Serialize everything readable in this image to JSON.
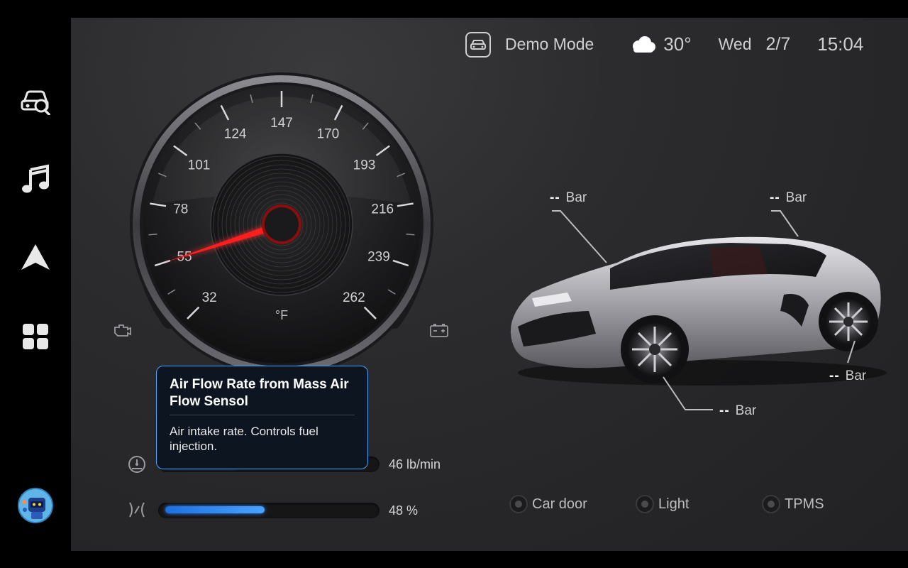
{
  "header": {
    "mode_label": "Demo Mode",
    "temperature": "30°",
    "day": "Wed",
    "date": "2/7",
    "time": "15:04"
  },
  "sidebar": {
    "items": [
      {
        "name": "car-diagnostics",
        "icon": "car-search-icon"
      },
      {
        "name": "music",
        "icon": "music-note-icon"
      },
      {
        "name": "navigation",
        "icon": "navigation-arrow-icon"
      },
      {
        "name": "apps",
        "icon": "apps-grid-icon"
      },
      {
        "name": "assistant",
        "icon": "robot-avatar-icon"
      }
    ]
  },
  "gauge": {
    "ticks": [
      "32",
      "55",
      "78",
      "101",
      "124",
      "147",
      "170",
      "193",
      "216",
      "239",
      "262"
    ],
    "unit": "°F",
    "needle_value": 55,
    "left_arc_icon": "engine-icon",
    "right_arc_icon": "battery-icon",
    "accent": "#2f8cff",
    "needle_color": "#ff1e1e"
  },
  "tire_pressure": {
    "front_left": {
      "value": "--",
      "unit": "Bar"
    },
    "rear_right_top": {
      "value": "--",
      "unit": "Bar"
    },
    "rear_right": {
      "value": "--",
      "unit": "Bar"
    },
    "front_bottom": {
      "value": "--",
      "unit": "Bar"
    }
  },
  "metrics": [
    {
      "icon": "gauge-icon",
      "value": "46",
      "unit": "lb/min",
      "fill": 0.35
    },
    {
      "icon": "throttle-icon",
      "value": "48",
      "unit": "%",
      "fill": 0.48
    }
  ],
  "tooltip": {
    "title": "Air Flow Rate from Mass Air Flow Sensol",
    "body": "Air intake rate. Controls fuel injection."
  },
  "status_indicators": [
    {
      "label": "Car door"
    },
    {
      "label": "Light"
    },
    {
      "label": "TPMS"
    }
  ]
}
